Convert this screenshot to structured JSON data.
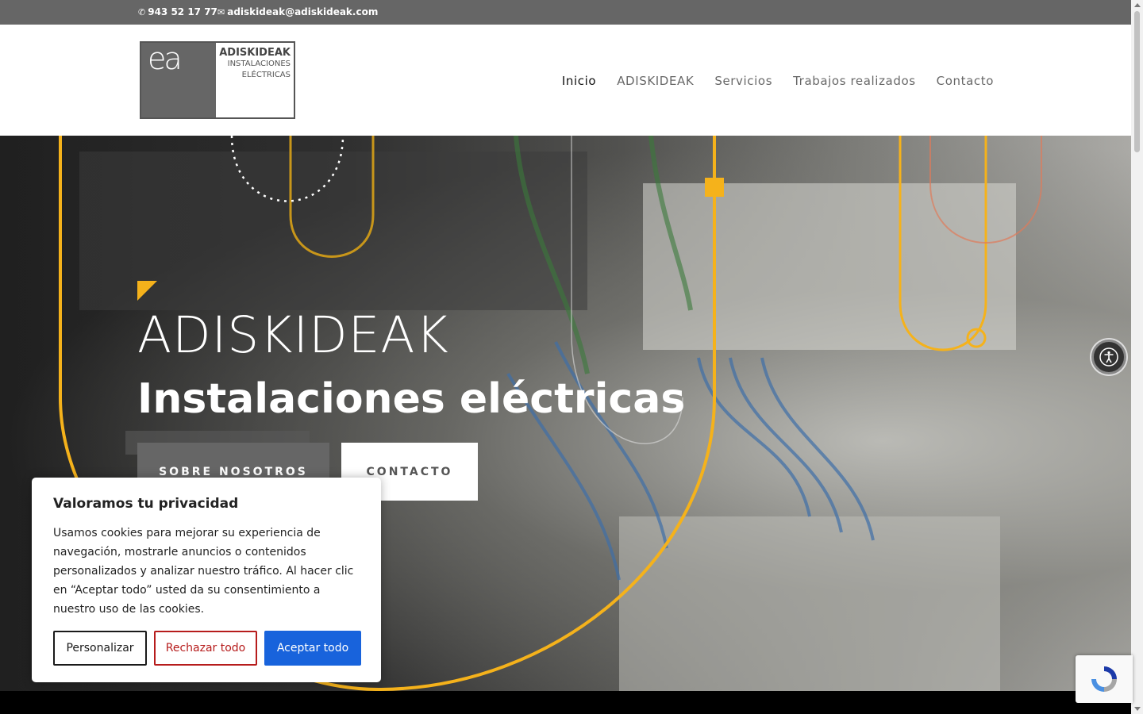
{
  "topbar": {
    "phone": "943 52 17 77",
    "email": "adiskideak@adiskideak.com"
  },
  "logo": {
    "mark": "ea",
    "name": "ADISKIDEAK",
    "line1": "INSTALACIONES",
    "line2": "ELÉCTRICAS"
  },
  "nav": {
    "items": [
      "Inicio",
      "ADISKIDEAK",
      "Servicios",
      "Trabajos realizados",
      "Contacto"
    ],
    "active": "Inicio"
  },
  "hero": {
    "title": "ADISKIDEAK",
    "subtitle": "Instalaciones eléctricas",
    "btn_about": "SOBRE NOSOTROS",
    "btn_contact": "CONTACTO"
  },
  "cookie": {
    "title": "Valoramos tu privacidad",
    "text": "Usamos cookies para mejorar su experiencia de navegación, mostrarle anuncios o contenidos personalizados y analizar nuestro tráfico. Al hacer clic en “Aceptar todo” usted da su consentimiento a nuestro uso de las cookies.",
    "customize": "Personalizar",
    "reject": "Rechazar todo",
    "accept": "Aceptar todo"
  },
  "colors": {
    "accent": "#f5b21b",
    "topbar": "#666666",
    "accept_btn": "#1863dc",
    "reject_btn": "#b61c1c"
  },
  "icons": [
    "phone-icon",
    "mail-icon",
    "accessibility-icon",
    "recaptcha-icon"
  ]
}
